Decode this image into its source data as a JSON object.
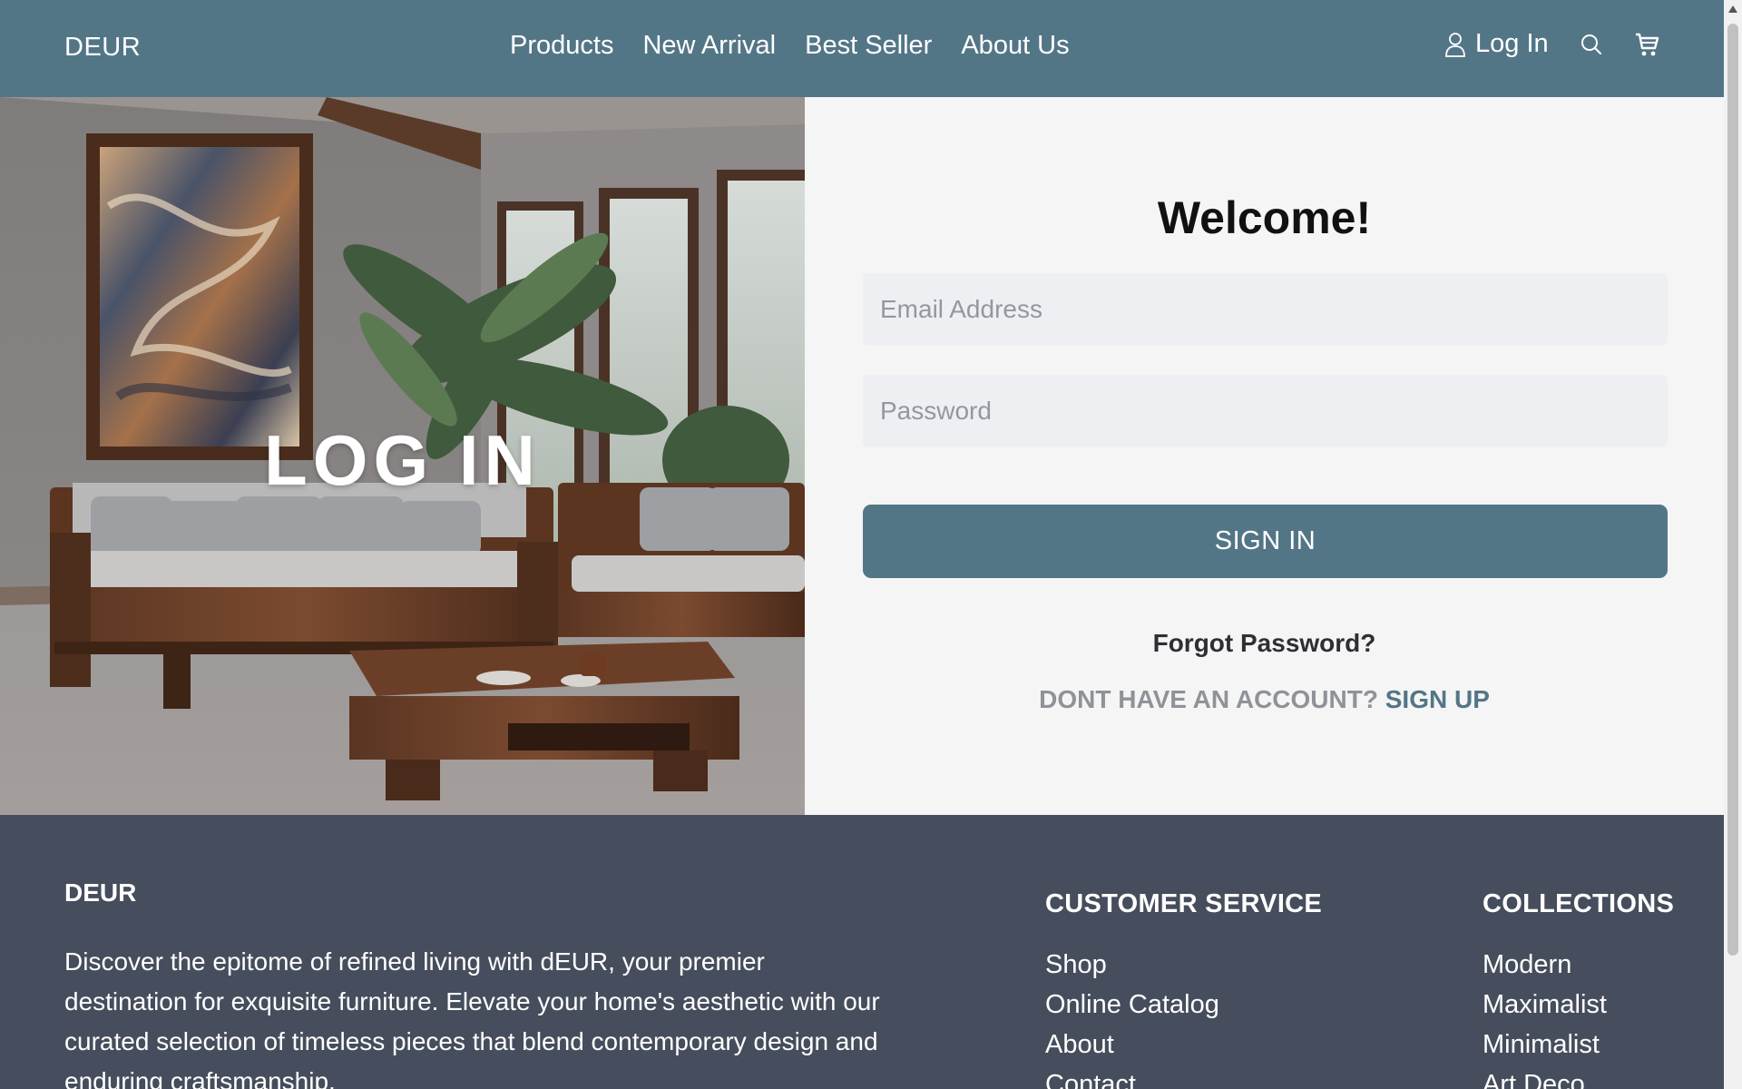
{
  "header": {
    "brand": "DEUR",
    "nav": [
      "Products",
      "New Arrival",
      "Best Seller",
      "About Us"
    ],
    "login_label": "Log In",
    "icons": {
      "user": "user-icon",
      "search": "search-icon",
      "cart": "cart-icon"
    }
  },
  "hero": {
    "title": "LOG IN"
  },
  "login": {
    "welcome": "Welcome!",
    "email_placeholder": "Email Address",
    "password_placeholder": "Password",
    "signin_label": "SIGN IN",
    "forgot_label": "Forgot Password?",
    "no_account_text": "DONT HAVE AN ACCOUNT?",
    "signup_label": "SIGN UP"
  },
  "footer": {
    "brand": "DEUR",
    "description": "Discover the epitome of refined living with dEUR, your premier destination for exquisite furniture. Elevate your home's aesthetic with our curated selection of timeless pieces that blend contemporary design and enduring craftsmanship.",
    "customer_service": {
      "heading": "CUSTOMER SERVICE",
      "items": [
        "Shop",
        "Online Catalog",
        "About",
        "Contact"
      ]
    },
    "collections": {
      "heading": "COLLECTIONS",
      "items": [
        "Modern",
        "Maximalist",
        "Minimalist",
        "Art Deco"
      ]
    }
  },
  "colors": {
    "header_bg": "#537686",
    "accent": "#537686",
    "footer_bg": "#464d5c",
    "panel_bg": "#f5f5f5"
  }
}
